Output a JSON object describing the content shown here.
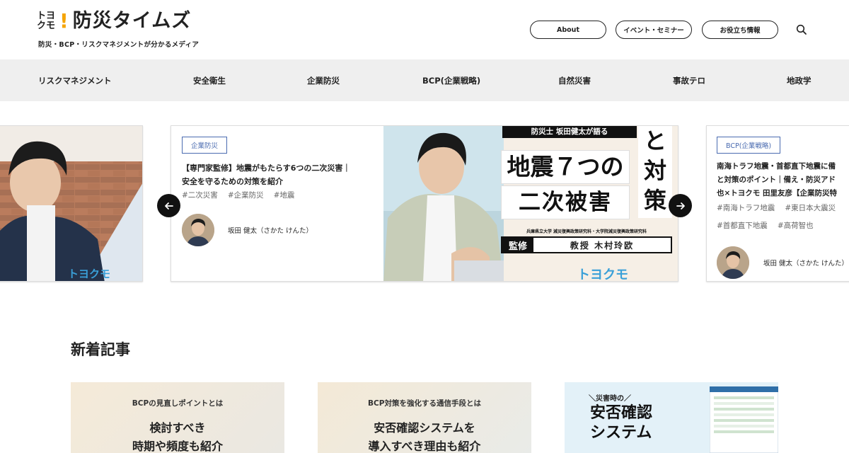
{
  "header": {
    "logo_mark_top": "トヨ",
    "logo_mark_bottom": "クモ",
    "logo_bang": "!",
    "logo_title": "防災タイムズ",
    "tagline": "防災・BCP・リスクマネジメントが分かるメディア",
    "buttons": [
      "About",
      "イベント・セミナー",
      "お役立ち情報"
    ]
  },
  "nav": {
    "items": [
      "リスクマネジメント",
      "安全衛生",
      "企業防災",
      "BCP(企業戦略)",
      "自然災害",
      "事故テロ",
      "地政学"
    ]
  },
  "carousel": {
    "main": {
      "tag": "企業防災",
      "title_line1": "【専門家監修】地震がもたらす6つの二次災害｜",
      "title_line2": "安全を守るための対策を紹介",
      "tags": [
        "#二次災害",
        "#企業防災",
        "#地震"
      ],
      "author": "坂田 健太（さかた けんた）",
      "image": {
        "header": "防災士 坂田健太が語る",
        "line1": "地震７つの",
        "line2": "二次被害",
        "side1": "と",
        "side2": "対",
        "side3": "策",
        "affiliation": "兵庫県立大学 減災復興政策研究科・大学院減災復興政策研究科",
        "supervisor_label": "監修",
        "supervisor": "教授 木村玲欧",
        "brand": "トヨクモ"
      }
    },
    "left_brand": "トヨクモ",
    "right": {
      "tag": "BCP(企業戦略)",
      "title_line1": "南海トラフ地震・首都直下地震に備",
      "title_line2": "と対策のポイント｜備え・防災アド",
      "title_line3": "也×トヨクモ 田里友彦【企業防災特",
      "tags": [
        "#南海トラフ地震",
        "#東日本大震災",
        "#首都直下地震",
        "#高荷智也"
      ],
      "author": "坂田 健太（さかた けんた）"
    }
  },
  "news": {
    "title": "新着記事",
    "cards": [
      {
        "sub": "BCPの見直しポイントとは",
        "main1": "検討すべき",
        "main2": "時期や頻度も紹介"
      },
      {
        "sub": "BCP対策を強化する通信手段とは",
        "main1": "安否確認システムを",
        "main2": "導入すべき理由も紹介"
      },
      {
        "sub": "＼災害時の／",
        "main1": "安否確認",
        "main2": "システム"
      }
    ]
  },
  "colors": {
    "accent": "#f5a400",
    "tag_blue": "#4a6bb0",
    "nav_bg": "#efefef"
  }
}
